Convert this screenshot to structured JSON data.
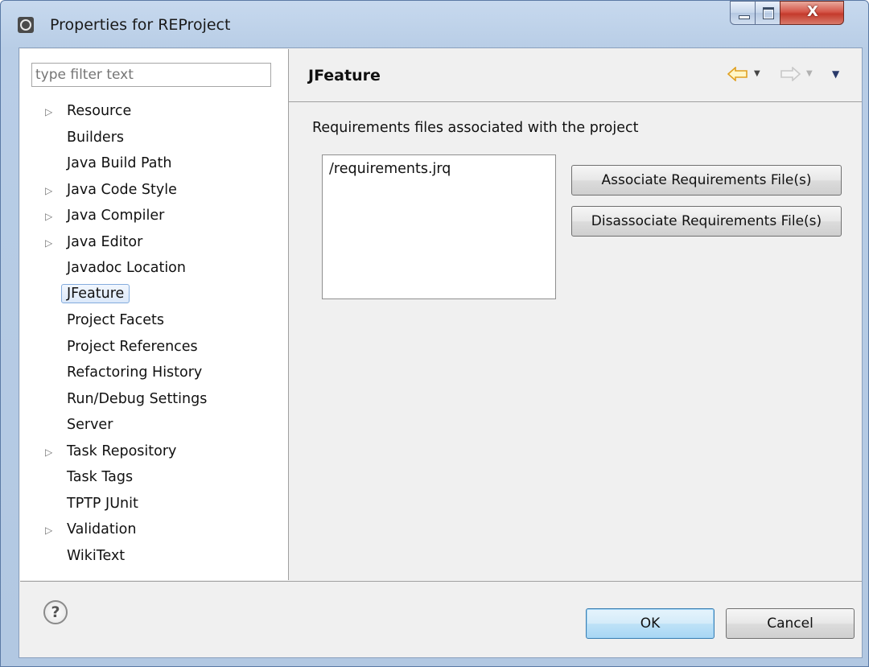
{
  "window": {
    "title": "Properties for REProject",
    "controls": {
      "minimize_icon": "minimize-icon",
      "maximize_icon": "maximize-icon",
      "close_label": "X"
    }
  },
  "filter": {
    "placeholder": "type filter text",
    "value": ""
  },
  "tree": {
    "items": [
      {
        "label": "Resource",
        "expandable": true
      },
      {
        "label": "Builders",
        "expandable": false
      },
      {
        "label": "Java Build Path",
        "expandable": false
      },
      {
        "label": "Java Code Style",
        "expandable": true
      },
      {
        "label": "Java Compiler",
        "expandable": true
      },
      {
        "label": "Java Editor",
        "expandable": true
      },
      {
        "label": "Javadoc Location",
        "expandable": false
      },
      {
        "label": "JFeature",
        "expandable": false,
        "selected": true
      },
      {
        "label": "Project Facets",
        "expandable": false
      },
      {
        "label": "Project References",
        "expandable": false
      },
      {
        "label": "Refactoring History",
        "expandable": false
      },
      {
        "label": "Run/Debug Settings",
        "expandable": false
      },
      {
        "label": "Server",
        "expandable": false
      },
      {
        "label": "Task Repository",
        "expandable": true
      },
      {
        "label": "Task Tags",
        "expandable": false
      },
      {
        "label": "TPTP JUnit",
        "expandable": false
      },
      {
        "label": "Validation",
        "expandable": true
      },
      {
        "label": "WikiText",
        "expandable": false
      }
    ]
  },
  "page": {
    "title": "JFeature",
    "description": "Requirements files associated with the project",
    "files": [
      "/requirements.jrq"
    ],
    "associate_label": "Associate Requirements File(s)",
    "disassociate_label": "Disassociate Requirements File(s)"
  },
  "footer": {
    "help_label": "?",
    "ok_label": "OK",
    "cancel_label": "Cancel"
  },
  "colors": {
    "nav_arrow": "#f0c040",
    "nav_arrow_disabled": "#c8c8c8"
  }
}
